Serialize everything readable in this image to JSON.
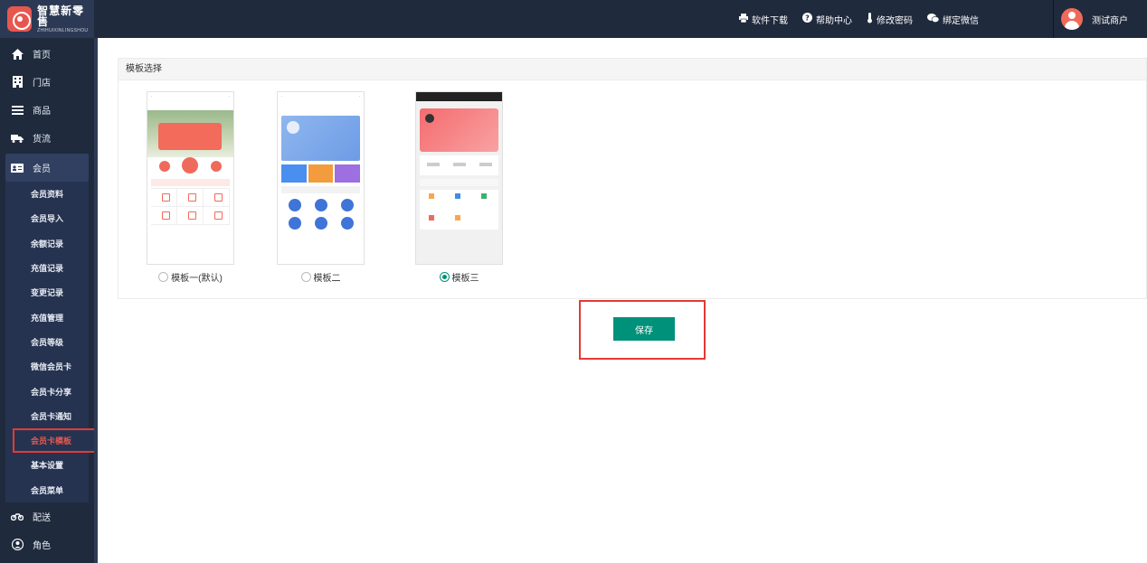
{
  "brand": {
    "title": "智慧新零售",
    "subtitle": "ZHIHUIXINLINGSHOU"
  },
  "topbar": {
    "links": [
      {
        "label": "软件下载",
        "icon": "printer-icon"
      },
      {
        "label": "帮助中心",
        "icon": "help-icon"
      },
      {
        "label": "修改密码",
        "icon": "thermometer-icon"
      },
      {
        "label": "绑定微信",
        "icon": "wechat-icon"
      }
    ],
    "user": "测试商户"
  },
  "sidebar": {
    "items": [
      {
        "label": "首页",
        "icon": "home-icon"
      },
      {
        "label": "门店",
        "icon": "building-icon"
      },
      {
        "label": "商品",
        "icon": "list-icon"
      },
      {
        "label": "货流",
        "icon": "truck-icon"
      },
      {
        "label": "会员",
        "icon": "id-card-icon"
      }
    ],
    "member_submenu": [
      "会员资料",
      "会员导入",
      "余额记录",
      "充值记录",
      "变更记录",
      "充值管理",
      "会员等级",
      "微信会员卡",
      "会员卡分享",
      "会员卡通知",
      "会员卡模板",
      "基本设置",
      "会员菜单"
    ],
    "active_sub": "会员卡模板",
    "after_items": [
      {
        "label": "配送",
        "icon": "motorcycle-icon"
      },
      {
        "label": "角色",
        "icon": "user-circle-icon"
      }
    ]
  },
  "panel": {
    "title": "模板选择",
    "templates": [
      {
        "label": "模板一(默认)",
        "selected": false
      },
      {
        "label": "模板二",
        "selected": false
      },
      {
        "label": "模板三",
        "selected": true
      }
    ]
  },
  "actions": {
    "save": "保存"
  },
  "colors": {
    "sidebar": "#1f2a3d",
    "accent": "#00917a",
    "highlight": "#e53935"
  }
}
